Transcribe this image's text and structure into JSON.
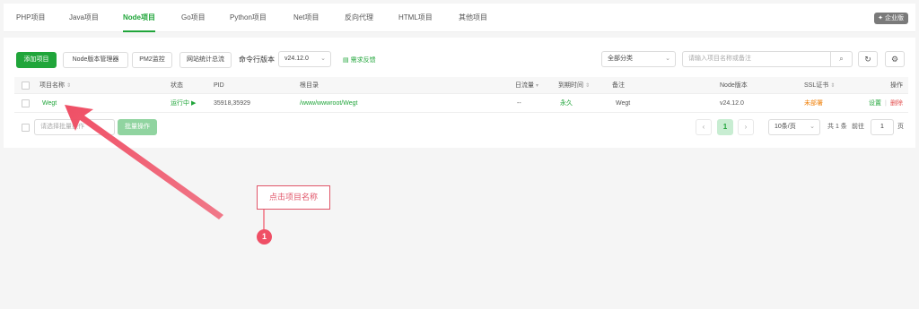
{
  "tabs": [
    {
      "label": "PHP项目"
    },
    {
      "label": "Java项目"
    },
    {
      "label": "Node项目"
    },
    {
      "label": "Go项目"
    },
    {
      "label": "Python项目"
    },
    {
      "label": "Net项目"
    },
    {
      "label": "反向代理"
    },
    {
      "label": "HTML项目"
    },
    {
      "label": "其他项目"
    }
  ],
  "active_tab": "Node项目",
  "enterprise_badge": "企业版",
  "toolbar": {
    "add_project": "添加项目",
    "node_version_manager": "Node版本管理器",
    "pm2_monitor": "PM2监控",
    "site_traffic": "网站统计总流",
    "cli_version_label": "命令行版本",
    "cli_version_value": "v24.12.0",
    "feedback": "需求反馈",
    "category_select": "全部分类",
    "search_placeholder": "请输入项目名称或备注"
  },
  "table": {
    "headers": {
      "name": "项目名称",
      "status": "状态",
      "pid": "PID",
      "root": "根目录",
      "traffic": "日流量",
      "expire": "到期时间",
      "remark": "备注",
      "node_version": "Node版本",
      "ssl": "SSL证书",
      "actions": "操作"
    },
    "rows": [
      {
        "name": "Wegt",
        "status": "运行中 ▶",
        "pid": "35918,35929",
        "root": "/www/wwwroot/Wegt",
        "traffic": "--",
        "expire": "永久",
        "remark": "Wegt",
        "node_version": "v24.12.0",
        "ssl": "未部署",
        "action_settings": "设置",
        "action_sep": "|",
        "action_delete": "删除"
      }
    ]
  },
  "batch": {
    "select_placeholder": "请选择批量操作",
    "button": "批量操作"
  },
  "pagination": {
    "prev": "‹",
    "current": "1",
    "next": "›",
    "page_size": "10条/页",
    "total": "共 1 条",
    "goto_label": "前往",
    "goto_value": "1",
    "page_suffix": "页"
  },
  "annotation": {
    "text": "点击项目名称",
    "step": "1"
  },
  "colors": {
    "accent": "#20a53a",
    "annotation": "#ef4f65",
    "ssl_warning": "#f0800a",
    "delete": "#e34f4f"
  }
}
